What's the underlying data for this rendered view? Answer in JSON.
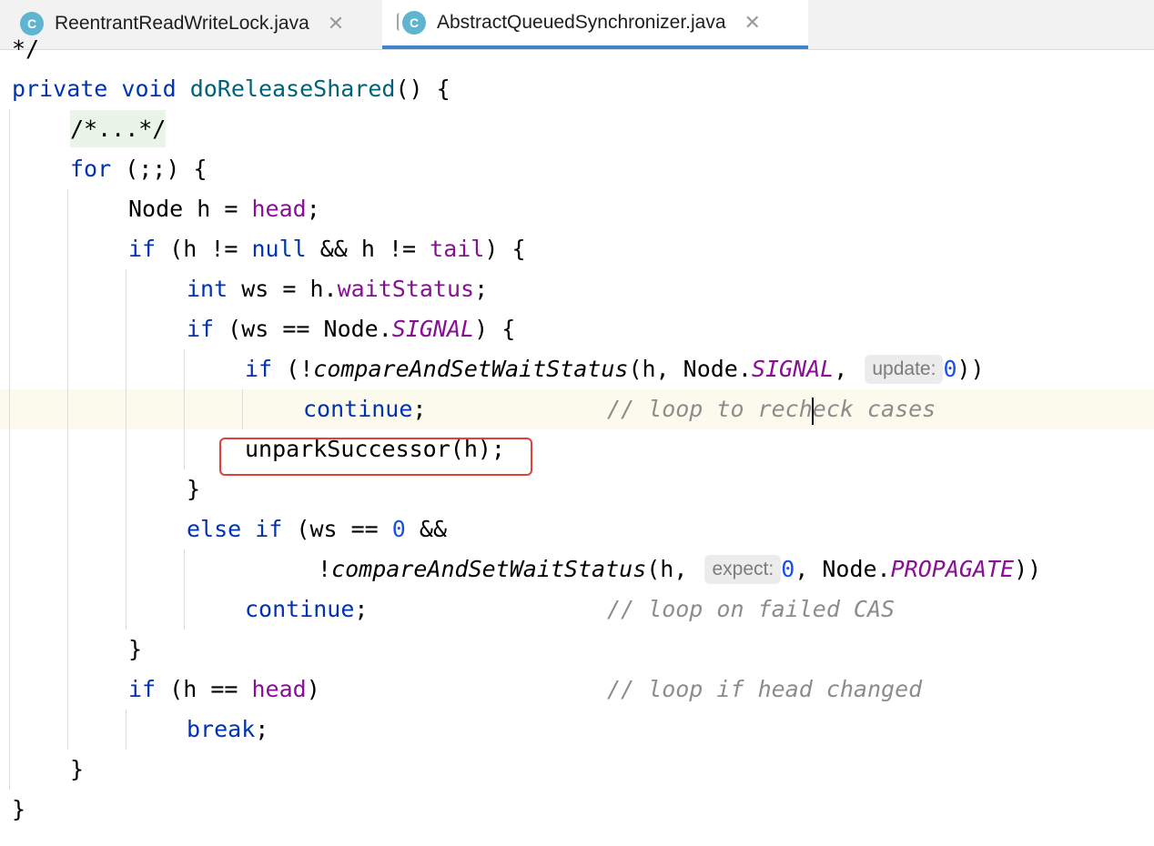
{
  "tabs": [
    {
      "label": "ReentrantReadWriteLock.java",
      "icon": "C",
      "active": false
    },
    {
      "label": "AbstractQueuedSynchronizer.java",
      "icon": "C",
      "active": true
    }
  ],
  "code": {
    "line0": "*/",
    "l1_kw": "private void",
    "l1_fn": "doReleaseShared",
    "l1_rest": "() {",
    "fold": "/*...*/",
    "l3_kw": "for",
    "l3_rest": " (;;) {",
    "l4_a": "Node h = ",
    "l4_fld": "head",
    "l4_b": ";",
    "l5_if": "if",
    "l5_a": " (h != ",
    "l5_null": "null",
    "l5_b": " && h != ",
    "l5_fld": "tail",
    "l5_c": ") {",
    "l6_kw": "int",
    "l6_a": " ws = h.",
    "l6_fld": "waitStatus",
    "l6_b": ";",
    "l7_if": "if",
    "l7_a": " (ws == Node.",
    "l7_fld": "SIGNAL",
    "l7_b": ") {",
    "l8_if": "if",
    "l8_a": " (!",
    "l8_call": "compareAndSetWaitStatus",
    "l8_b": "(h, Node.",
    "l8_fld": "SIGNAL",
    "l8_c": ",",
    "l8_hint": "update:",
    "l8_num": "0",
    "l8_d": "))",
    "l9_kw": "continue",
    "l9_a": ";",
    "l9_cm": "// loop to recheck cases",
    "l10": "unparkSuccessor(h);",
    "l11": "}",
    "l12_kw": "else if",
    "l12_a": " (ws == ",
    "l12_num": "0",
    "l12_b": " &&",
    "l13_a": "!",
    "l13_call": "compareAndSetWaitStatus",
    "l13_b": "(h,",
    "l13_hint": "expect:",
    "l13_num": "0",
    "l13_c": ", Node.",
    "l13_fld": "PROPAGATE",
    "l13_d": "))",
    "l14_kw": "continue",
    "l14_a": ";",
    "l14_cm": "// loop on failed CAS",
    "l15": "}",
    "l16_if": "if",
    "l16_a": " (h == ",
    "l16_fld": "head",
    "l16_b": ")",
    "l16_cm": "// loop if head changed",
    "l17_kw": "break",
    "l17_a": ";",
    "l18": "}",
    "l19": "}"
  }
}
